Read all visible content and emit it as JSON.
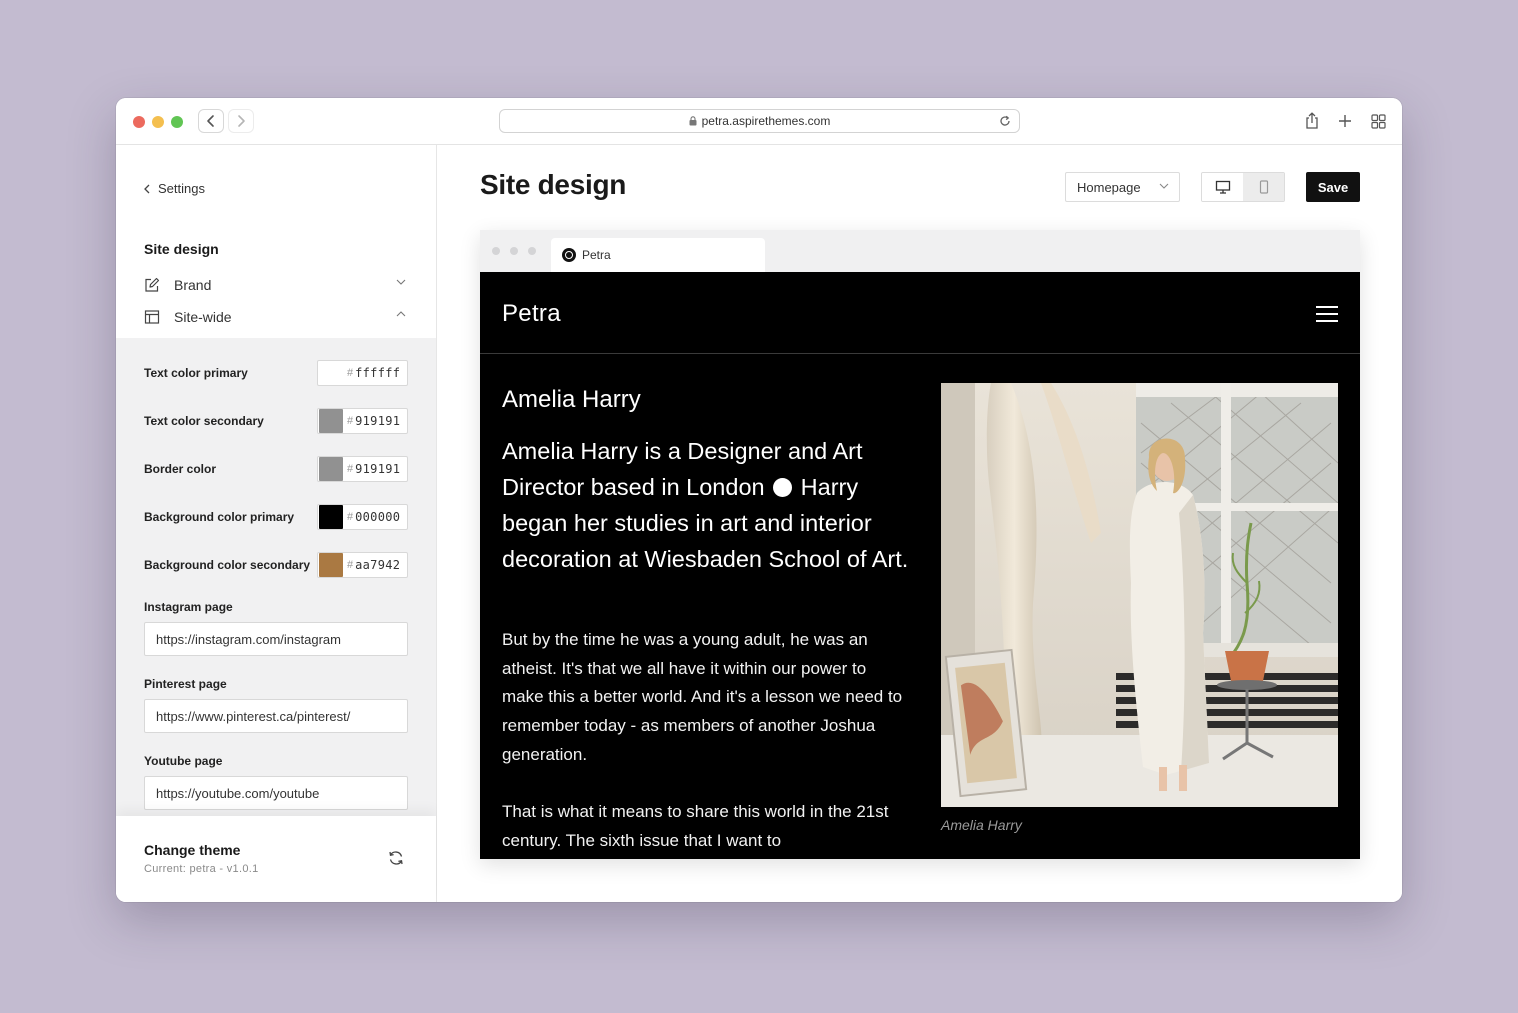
{
  "browser": {
    "url": "petra.aspirethemes.com",
    "traffic_lights": [
      "#ec6a5e",
      "#f4bf4f",
      "#61c554"
    ]
  },
  "sidebar": {
    "back_label": "Settings",
    "heading": "Site design",
    "sections": [
      {
        "label": "Brand",
        "icon": "edit-icon",
        "expanded": false
      },
      {
        "label": "Site-wide",
        "icon": "layout-icon",
        "expanded": true
      }
    ],
    "colors": [
      {
        "label": "Text color primary",
        "hash": "#",
        "value": "ffffff",
        "swatch": "#ffffff"
      },
      {
        "label": "Text color secondary",
        "hash": "#",
        "value": "919191",
        "swatch": "#919191"
      },
      {
        "label": "Border color",
        "hash": "#",
        "value": "919191",
        "swatch": "#919191"
      },
      {
        "label": "Background color primary",
        "hash": "#",
        "value": "000000",
        "swatch": "#000000"
      },
      {
        "label": "Background color secondary",
        "hash": "#",
        "value": "aa7942",
        "swatch": "#aa7942"
      }
    ],
    "fields": [
      {
        "label": "Instagram page",
        "value": "https://instagram.com/instagram"
      },
      {
        "label": "Pinterest page",
        "value": "https://www.pinterest.ca/pinterest/"
      },
      {
        "label": "Youtube page",
        "value": "https://youtube.com/youtube"
      }
    ],
    "theme": {
      "title": "Change theme",
      "current": "Current: petra - v1.0.1"
    }
  },
  "main": {
    "title": "Site design",
    "page_select": "Homepage",
    "save_label": "Save"
  },
  "preview": {
    "tab_title": "Petra",
    "logo": "Petra",
    "name": "Amelia Harry",
    "lead_part1": "Amelia Harry is a Designer and Art Director based in London",
    "lead_part2": "Harry began her studies in art and interior decoration at Wiesbaden School of Art.",
    "paragraph1": "But by the time he was a young adult, he was an atheist. It's that we all have it within our power to make this a better world. And it's a lesson we need to remember today - as members of another Joshua generation.",
    "paragraph2": "That is what it means to share this world in the 21st century. The sixth issue that I want to",
    "caption": "Amelia Harry"
  }
}
